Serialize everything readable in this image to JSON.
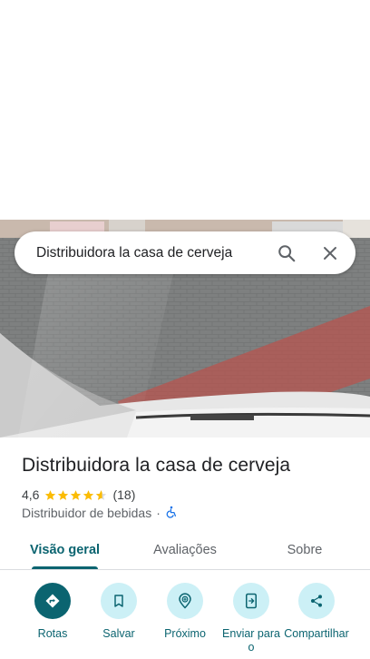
{
  "search": {
    "query": "Distribuidora la casa de cerveja"
  },
  "place": {
    "name": "Distribuidora la casa de cerveja",
    "rating": "4,6",
    "rating_value": 4.6,
    "review_count": "(18)",
    "category": "Distribuidor de bebidas",
    "separator": "·"
  },
  "tabs": [
    {
      "label": "Visão geral",
      "active": true
    },
    {
      "label": "Avaliações",
      "active": false
    },
    {
      "label": "Sobre",
      "active": false
    }
  ],
  "actions": [
    {
      "label": "Rotas",
      "icon": "directions-icon"
    },
    {
      "label": "Salvar",
      "icon": "bookmark-icon"
    },
    {
      "label": "Próximo",
      "icon": "nearby-icon"
    },
    {
      "label": "Enviar para o",
      "icon": "send-to-phone-icon"
    },
    {
      "label": "Compartilhar",
      "icon": "share-icon"
    }
  ],
  "colors": {
    "accent": "#0b6470",
    "action_bg": "#ccf0f6",
    "star": "#fbbc04",
    "accessibility": "#1a73e8"
  }
}
